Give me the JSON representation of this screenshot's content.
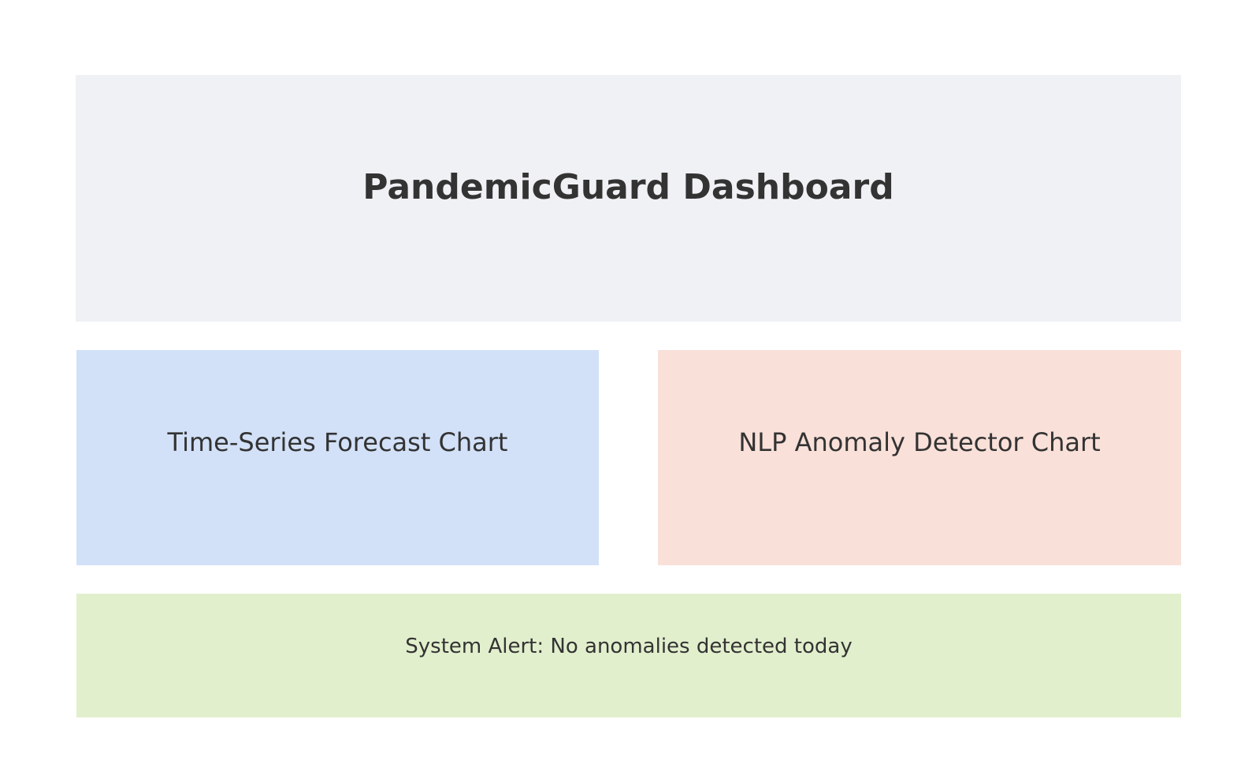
{
  "colors": {
    "header_bg": "#F0F1F5",
    "forecast_bg": "#D2E1F8",
    "anomaly_bg": "#F9E0D9",
    "alert_bg": "#E2EFCD",
    "text": "#333333"
  },
  "header": {
    "title": "PandemicGuard Dashboard"
  },
  "panels": {
    "forecast": {
      "label": "Time-Series Forecast Chart"
    },
    "anomaly": {
      "label": "NLP Anomaly Detector Chart"
    }
  },
  "alert": {
    "text": "System Alert: No anomalies detected today"
  }
}
